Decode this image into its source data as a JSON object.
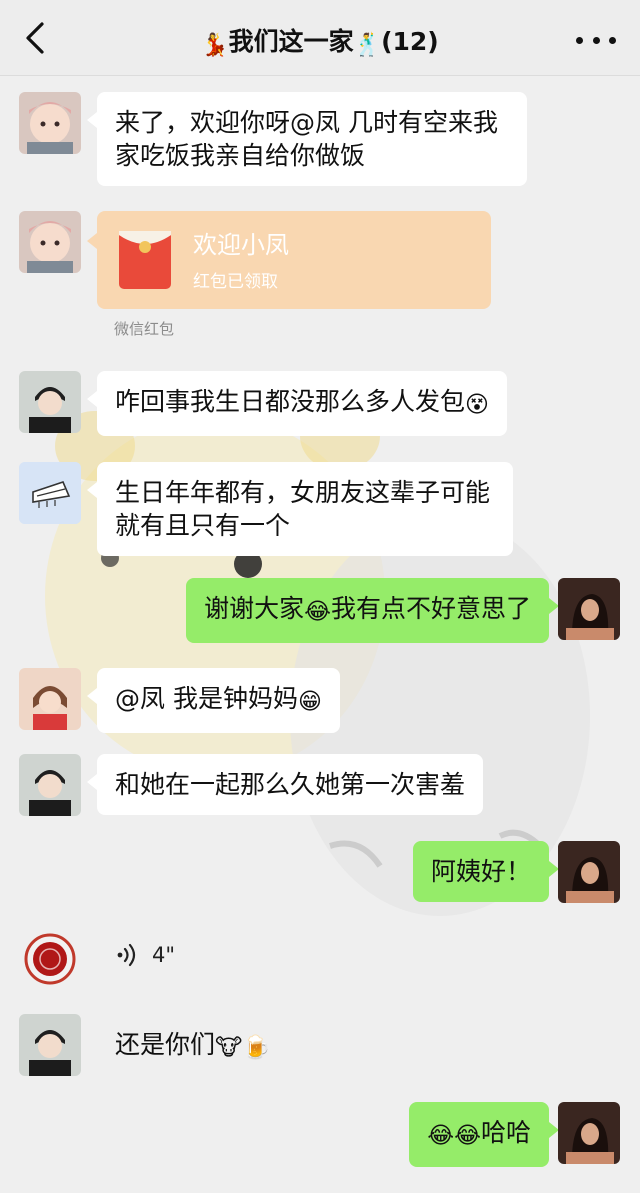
{
  "header": {
    "title": "我们这一家",
    "member_count": "(12)",
    "left_emoji": "💃",
    "right_emoji": "🕺"
  },
  "messages": {
    "m1": "来了，欢迎你呀@凤 几时有空来我家吃饭我亲自给你做饭",
    "red_packet": {
      "title": "欢迎小凤",
      "status": "红包已领取",
      "label": "微信红包"
    },
    "m3": "咋回事我生日都没那么多人发包",
    "m3_emoji": "😵",
    "m4": "生日年年都有，女朋友这辈子可能就有且只有一个",
    "m5_a": "谢谢大家",
    "m5_emoji": "😂",
    "m5_b": "我有点不好意思了",
    "m6": "@凤 我是钟妈妈",
    "m6_emoji": "😁",
    "m7": "和她在一起那么久她第一次害羞",
    "m8": "阿姨好！",
    "voice_duration": "4\"",
    "m10": "还是你们",
    "m10_emoji_a": "🐮",
    "m10_emoji_b": "🍺",
    "m11_emoji": "😂😂",
    "m11": "哈哈"
  },
  "colors": {
    "bubble_self": "#95ec69",
    "bubble_other": "#ffffff",
    "red_packet": "#f9d7b1",
    "background": "#efefef"
  }
}
